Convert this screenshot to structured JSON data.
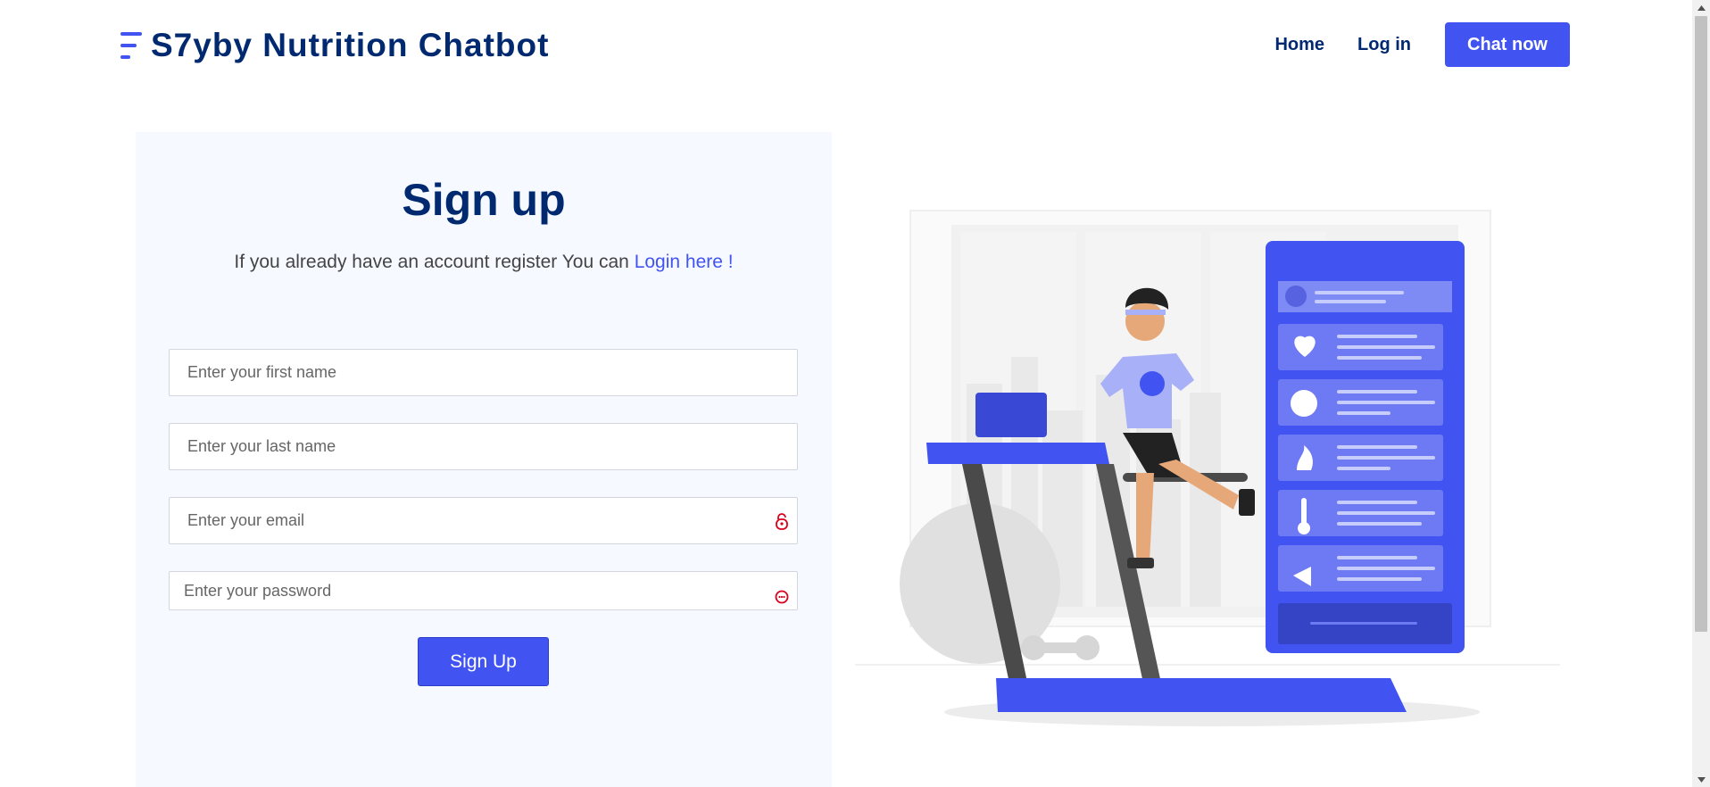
{
  "header": {
    "brand": "S7yby Nutrition Chatbot",
    "nav": {
      "home": "Home",
      "login": "Log in",
      "chat": "Chat now"
    }
  },
  "form": {
    "title": "Sign up",
    "subtitle_prefix": "If you already have an account register You can ",
    "subtitle_link": "Login here !",
    "first_name_placeholder": "Enter your first name",
    "last_name_placeholder": "Enter your last name",
    "email_placeholder": "Enter your email",
    "password_placeholder": "Enter your password",
    "submit_label": "Sign Up"
  },
  "colors": {
    "brand": "#4154f1",
    "heading": "#012970",
    "panel": "#f6f9ff",
    "autofill_icon": "#d9001b"
  },
  "icons": {
    "email_field": "lock-icon",
    "password_field": "key-icon"
  }
}
